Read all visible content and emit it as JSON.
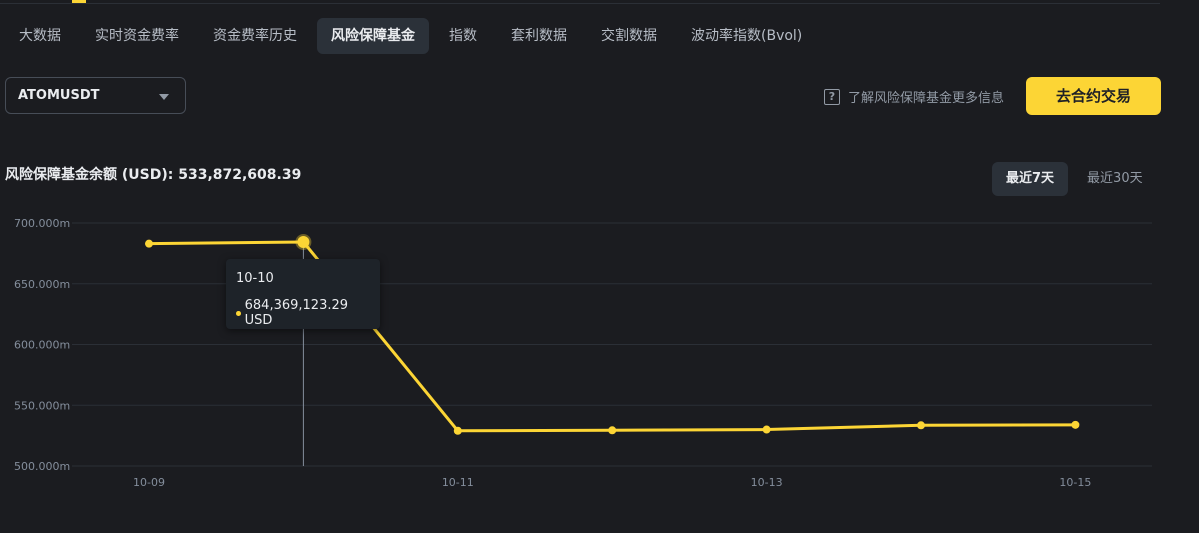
{
  "tabs": [
    {
      "label": "大数据",
      "active": false
    },
    {
      "label": "实时资金费率",
      "active": false
    },
    {
      "label": "资金费率历史",
      "active": false
    },
    {
      "label": "风险保障基金",
      "active": true
    },
    {
      "label": "指数",
      "active": false
    },
    {
      "label": "套利数据",
      "active": false
    },
    {
      "label": "交割数据",
      "active": false
    },
    {
      "label": "波动率指数(Bvol)",
      "active": false
    }
  ],
  "symbol_select": {
    "value": "ATOMUSDT"
  },
  "info_link": {
    "label": "了解风险保障基金更多信息"
  },
  "trade_button": {
    "label": "去合约交易"
  },
  "balance": {
    "text": "风险保障基金余额 (USD): 533,872,608.39"
  },
  "range": {
    "last7": "最近7天",
    "last30": "最近30天",
    "active": "last7"
  },
  "tooltip": {
    "date": "10-10",
    "value": "684,369,123.29 USD"
  },
  "colors": {
    "accent": "#fcd535",
    "background": "#1b1c20",
    "grid": "#2b2f36"
  },
  "chart_data": {
    "type": "line",
    "x": [
      "10-09",
      "10-10",
      "10-11",
      "10-12",
      "10-13",
      "10-14",
      "10-15"
    ],
    "xtick_labels": [
      "10-09",
      "10-11",
      "10-13",
      "10-15"
    ],
    "series": [
      {
        "values": [
          683000000,
          684369123.29,
          529000000,
          529400000,
          530000000,
          533500000,
          533872608.39
        ]
      }
    ],
    "ylim": [
      500000000,
      700000000
    ],
    "ytick_labels": [
      "700.000m",
      "650.000m",
      "600.000m",
      "550.000m",
      "500.000m"
    ],
    "ytick_values": [
      700000000,
      650000000,
      600000000,
      550000000,
      500000000
    ],
    "highlighted_index": 1,
    "grid": true
  }
}
